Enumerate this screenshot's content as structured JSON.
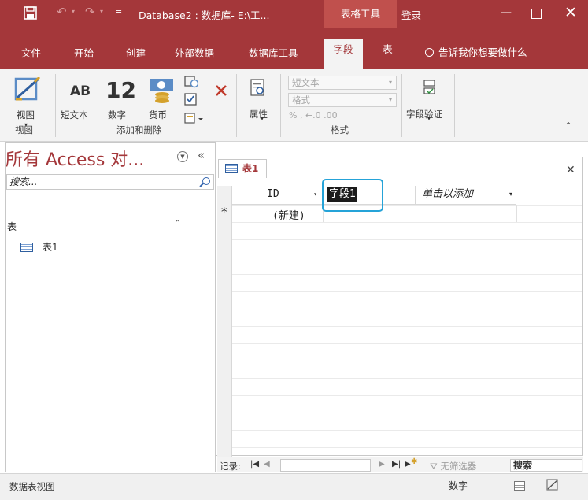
{
  "titlebar": {
    "title": "Database2 : 数据库- E:\\工...",
    "context_tab": "表格工具",
    "login": "登录",
    "qat_more": "="
  },
  "ribbon_tabs": [
    "文件",
    "开始",
    "创建",
    "外部数据",
    "数据库工具",
    "字段",
    "表"
  ],
  "tell_me": "告诉我你想要做什么",
  "ribbon": {
    "view_label": "视图",
    "view_group": "视图",
    "ab_glyph": "AB",
    "twelve_glyph": "12",
    "short_text": "短文本",
    "number": "数字",
    "currency": "货币",
    "add_delete_group": "添加和删除",
    "properties": "属性",
    "data_type_value": "短文本",
    "format_value": "格式",
    "format_row": "%  ,  ←.0 .00",
    "format_group": "格式",
    "field_validation": "字段验证"
  },
  "nav": {
    "title": "所有 Access 对...",
    "search_placeholder": "搜索...",
    "group": "表",
    "items": [
      "表1"
    ]
  },
  "doc": {
    "tab_label": "表1",
    "columns": {
      "id": "ID",
      "field1": "字段1",
      "add": "单击以添加"
    },
    "new_row_marker": "*",
    "new_row_value": "(新建)"
  },
  "record_bar": {
    "label": "记录:",
    "filter_label": "无筛选器",
    "search_value": "搜索"
  },
  "status": {
    "left": "数据表视图",
    "num_lock": "数字"
  },
  "colors": {
    "brand": "#a4373a",
    "context": "#c0504d",
    "highlight": "#25a3d8"
  }
}
